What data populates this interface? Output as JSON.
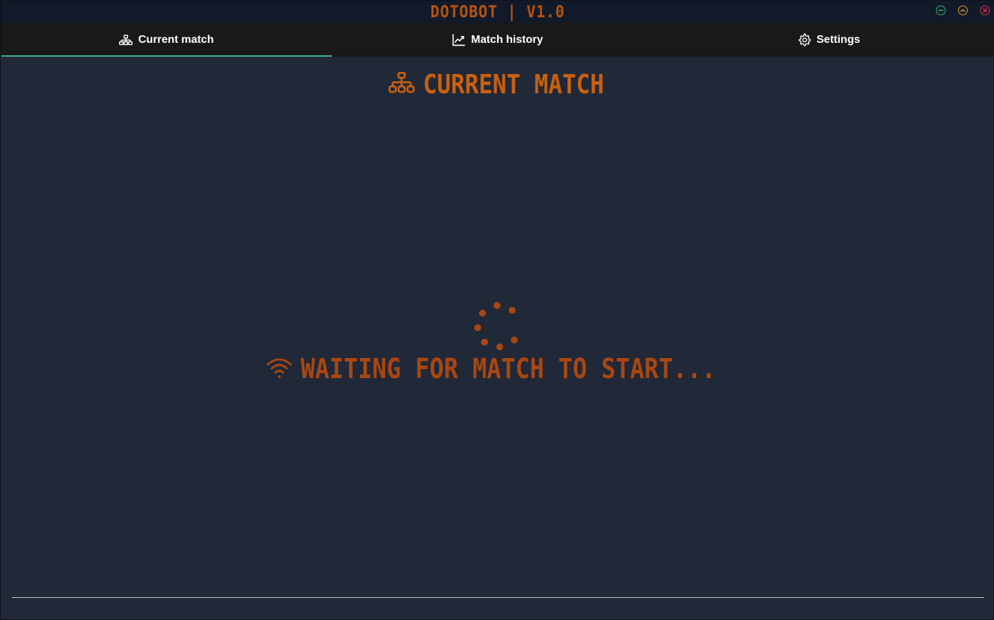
{
  "window": {
    "title": "DOTOBOT | V1.0",
    "controls": {
      "minimize": "minimize-icon",
      "maximize": "chevron-up-icon",
      "close": "close-icon"
    }
  },
  "tabs": [
    {
      "label": "Current match",
      "icon": "sitemap-icon",
      "active": true
    },
    {
      "label": "Match history",
      "icon": "line-chart-icon",
      "active": false
    },
    {
      "label": "Settings",
      "icon": "gear-icon",
      "active": false
    }
  ],
  "main": {
    "heading": "CURRENT MATCH",
    "heading_icon": "sitemap-icon",
    "status_text": "WAITING FOR MATCH TO START...",
    "status_icon": "wifi-icon",
    "loading_icon": "spinner-icon"
  },
  "colors": {
    "accent_orange": "#c9600f",
    "status_orange": "#a84710",
    "tab_underline": "#3fb68a",
    "minimize": "#2fb86a",
    "maximize": "#e2a21a",
    "close": "#e0304a",
    "background": "#212838",
    "tabbar": "#191919"
  }
}
